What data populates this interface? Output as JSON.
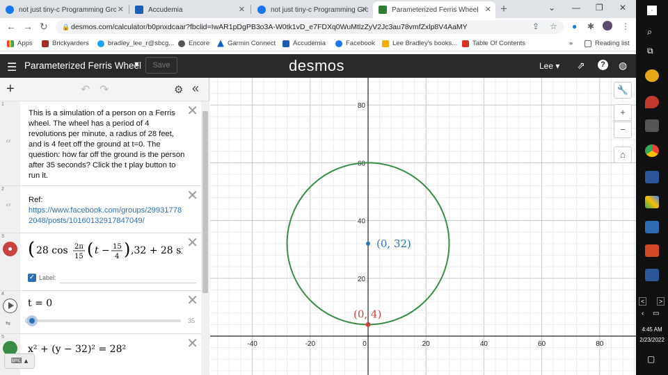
{
  "browser": {
    "tabs": [
      {
        "title": "not just tiny-c Programming Gro",
        "active": false
      },
      {
        "title": "Accudemia",
        "active": false
      },
      {
        "title": "not just tiny-c Programming Gro",
        "active": false
      },
      {
        "title": "Parameterized Ferris Wheel",
        "active": true
      }
    ],
    "url": "desmos.com/calculator/b0pnxdcaar?fbclid=IwAR1pDgPB3o3A-W0tk1vD_e7FDXq0WuMtlzZyV2Jc3au78vmfZxlp8V4AaMY",
    "bookmarks": [
      "Apps",
      "Brickyarders",
      "bradley_lee_r@sbcg...",
      "Encore",
      "Garmin Connect",
      "Accudemia",
      "Facebook",
      "Lee Bradley's books...",
      "Table Of Contents"
    ],
    "reading_list": "Reading list"
  },
  "header": {
    "graph_title": "Parameterized Ferris Wheel",
    "save_label": "Save",
    "logo": "desmos",
    "user": "Lee"
  },
  "expressions": {
    "note1": "This is a simulation of a person on a Ferris wheel. The wheel has a period of 4 revolutions per minute, a radius of 28 feet, and is 4 feet off the ground at t=0. The question: how far off the ground is the person after 35 seconds? Click the t play button to run it.",
    "note2_ref": "Ref:",
    "note2_link": "https://www.facebook.com/groups/299317782048/posts/10160132917847049/",
    "label_text": "Label:",
    "slider_eq": "t = 0",
    "slider_min": "0",
    "slider_max": "35",
    "slider_value": 0,
    "circle_eq": "x² + (y − 32)² = 28²"
  },
  "graph": {
    "x_ticks": [
      "-40",
      "-20",
      "0",
      "20",
      "40",
      "60",
      "80"
    ],
    "y_ticks": [
      "80",
      "60",
      "40",
      "20"
    ],
    "center_label": "(0, 32)",
    "point_label": "(0, 4)",
    "circle": {
      "cx": 0,
      "cy": 32,
      "r": 28
    },
    "center_point": {
      "x": 0,
      "y": 32
    },
    "moving_point": {
      "x": 0,
      "y": 4
    },
    "colors": {
      "circle": "#388c46",
      "center": "#2d70b3",
      "point": "#c74440"
    }
  },
  "system": {
    "time": "4:45 AM",
    "date": "2/23/2022"
  }
}
